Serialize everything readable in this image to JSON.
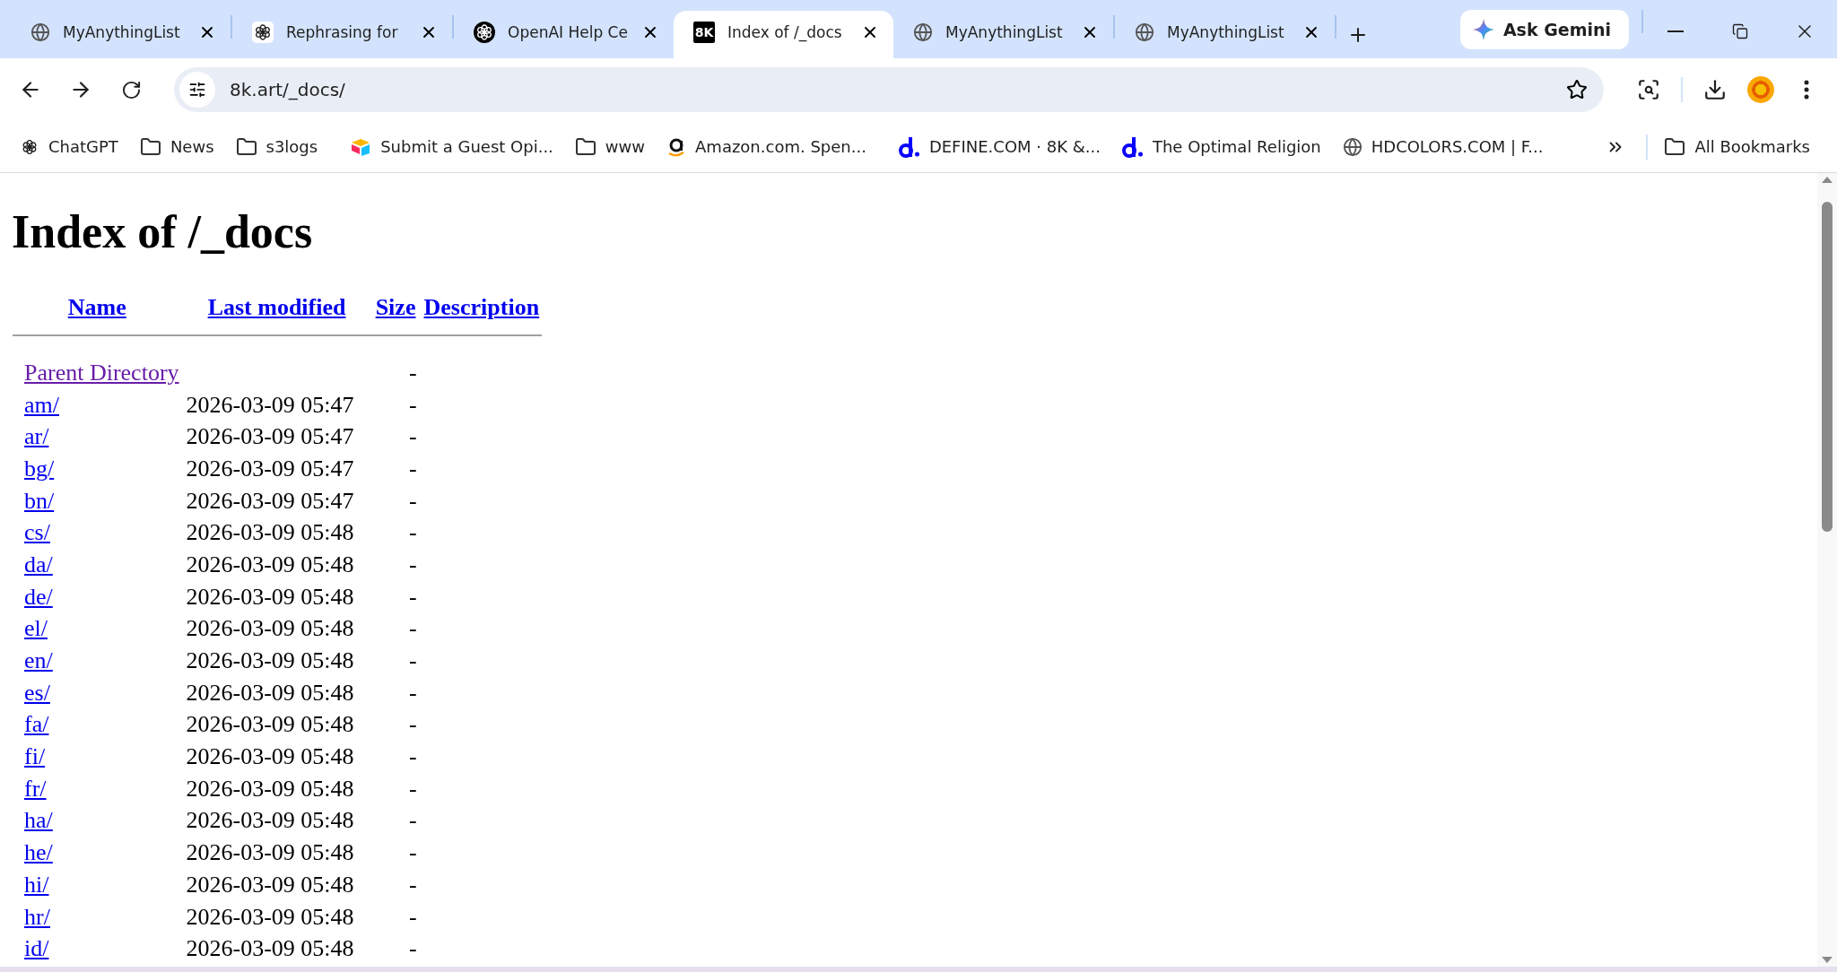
{
  "tabs": [
    {
      "title": "MyAnythingList",
      "kind": "globe",
      "selected": false
    },
    {
      "title": "Rephrasing for",
      "kind": "light",
      "selected": false
    },
    {
      "title": "OpenAI Help Ce",
      "kind": "dark",
      "selected": false
    },
    {
      "title": "Index of /_docs",
      "kind": "badge",
      "badge": "8K",
      "selected": true
    },
    {
      "title": "MyAnythingList",
      "kind": "globe",
      "selected": false
    },
    {
      "title": "MyAnythingList",
      "kind": "globe",
      "selected": false
    }
  ],
  "gemini_button": "Ask Gemini",
  "address": "8k.art/_docs/",
  "bookmarks": [
    {
      "label": "ChatGPT",
      "kind": "openai"
    },
    {
      "label": "News",
      "kind": "folder"
    },
    {
      "label": "s3logs",
      "kind": "folder"
    },
    {
      "label": "Submit a Guest Opi...",
      "kind": "airtable"
    },
    {
      "label": "www",
      "kind": "folder"
    },
    {
      "label": "Amazon.com. Spen...",
      "kind": "amazon"
    },
    {
      "label": "DEFINE.COM · 8K &...",
      "kind": "define"
    },
    {
      "label": "The Optimal Religion",
      "kind": "define"
    },
    {
      "label": "HDCOLORS.COM | F...",
      "kind": "globe"
    }
  ],
  "all_bookmarks": "All Bookmarks",
  "page": {
    "title": "Index of /_docs",
    "columns": [
      "Name",
      "Last modified",
      "Size",
      "Description"
    ],
    "rows": [
      {
        "name": "Parent Directory",
        "modified": "",
        "size": "-",
        "visited": true
      },
      {
        "name": "am/",
        "modified": "2026-03-09 05:47",
        "size": "-",
        "visited": false
      },
      {
        "name": "ar/",
        "modified": "2026-03-09 05:47",
        "size": "-",
        "visited": false
      },
      {
        "name": "bg/",
        "modified": "2026-03-09 05:47",
        "size": "-",
        "visited": false
      },
      {
        "name": "bn/",
        "modified": "2026-03-09 05:47",
        "size": "-",
        "visited": false
      },
      {
        "name": "cs/",
        "modified": "2026-03-09 05:48",
        "size": "-",
        "visited": false
      },
      {
        "name": "da/",
        "modified": "2026-03-09 05:48",
        "size": "-",
        "visited": false
      },
      {
        "name": "de/",
        "modified": "2026-03-09 05:48",
        "size": "-",
        "visited": false
      },
      {
        "name": "el/",
        "modified": "2026-03-09 05:48",
        "size": "-",
        "visited": false
      },
      {
        "name": "en/",
        "modified": "2026-03-09 05:48",
        "size": "-",
        "visited": false
      },
      {
        "name": "es/",
        "modified": "2026-03-09 05:48",
        "size": "-",
        "visited": false
      },
      {
        "name": "fa/",
        "modified": "2026-03-09 05:48",
        "size": "-",
        "visited": false
      },
      {
        "name": "fi/",
        "modified": "2026-03-09 05:48",
        "size": "-",
        "visited": false
      },
      {
        "name": "fr/",
        "modified": "2026-03-09 05:48",
        "size": "-",
        "visited": false
      },
      {
        "name": "ha/",
        "modified": "2026-03-09 05:48",
        "size": "-",
        "visited": false
      },
      {
        "name": "he/",
        "modified": "2026-03-09 05:48",
        "size": "-",
        "visited": false
      },
      {
        "name": "hi/",
        "modified": "2026-03-09 05:48",
        "size": "-",
        "visited": false
      },
      {
        "name": "hr/",
        "modified": "2026-03-09 05:48",
        "size": "-",
        "visited": false
      },
      {
        "name": "id/",
        "modified": "2026-03-09 05:48",
        "size": "-",
        "visited": false
      }
    ]
  }
}
